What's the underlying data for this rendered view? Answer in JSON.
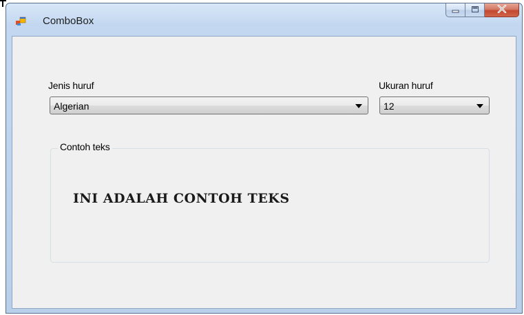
{
  "window": {
    "title": "ComboBox",
    "icon": "windows-form-icon",
    "caption_buttons": {
      "minimize_icon": "minimize-icon",
      "maximize_icon": "maximize-icon",
      "close_icon": "close-icon"
    }
  },
  "form": {
    "font_label": "Jenis huruf",
    "font_combo": {
      "selected": "Algerian"
    },
    "size_label": "Ukuran huruf",
    "size_combo": {
      "selected": "12"
    },
    "group": {
      "title": "Contoh teks",
      "sample_text": "INI ADALAH CONTOH TEKS"
    }
  },
  "colors": {
    "window_frame": "#c3d8f0",
    "client_bg": "#f0f0f0",
    "close_button": "#c3482f"
  }
}
